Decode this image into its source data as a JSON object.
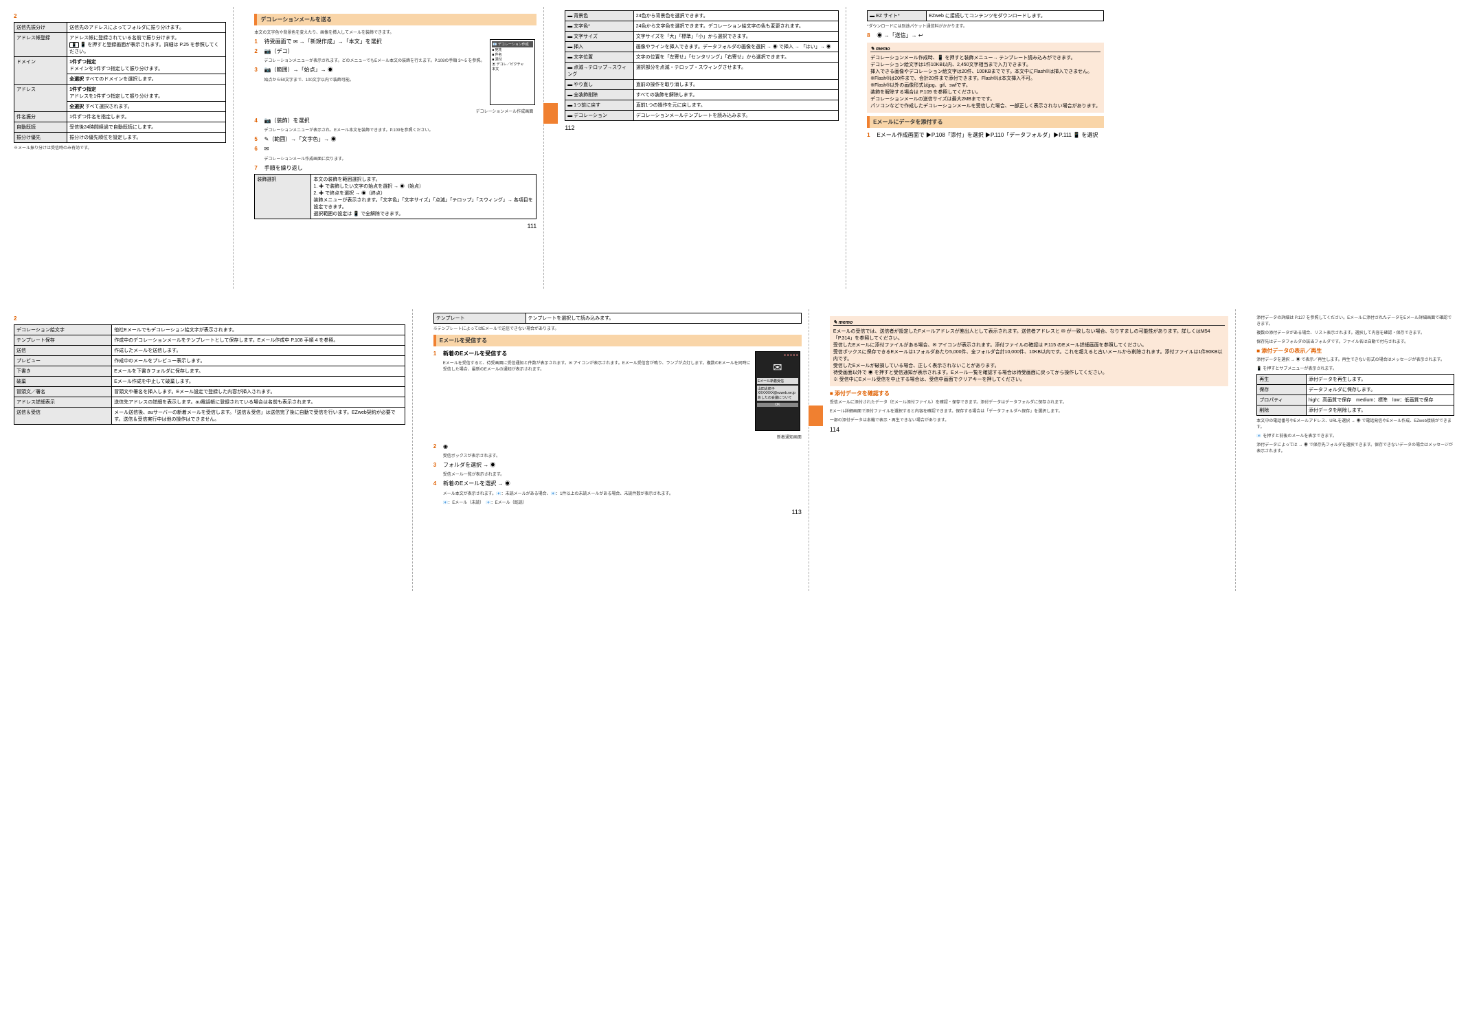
{
  "page111": {
    "number": "111",
    "section_title": "デコレーションメールを送る",
    "intro": "本文の文字色や背景色を変えたり、画像を挿入してメールを装飾できます。",
    "steps": [
      {
        "n": "1",
        "text": "待受画面で ✉ →「新規作成」→「本文」を選択"
      },
      {
        "n": "2",
        "text": "📷（デコ）",
        "note": "デコレーションメニューが表示されます。どのメニューでもEメール本文の装飾を行えます。P.108の手順 3～5 を参照。"
      },
      {
        "n": "3",
        "text": "📷（範囲）→「始点」→ ◉",
        "note": "始点から50文字まで、100文字以内で装飾可能。"
      },
      {
        "n": "4",
        "text": "📷（装飾）を選択",
        "note": "デコレーションメニューが表示され、Eメール本文を装飾できます。P.109を参照ください。"
      },
      {
        "n": "5",
        "text": "✎（範囲）→「文字色」→ ◉"
      },
      {
        "n": "6",
        "text": "✉",
        "note": "デコレーションメール作成画面に戻ります。"
      },
      {
        "n": "7",
        "text": "手順を繰り返し"
      }
    ],
    "table7": {
      "left": "装飾選択",
      "right_intro": "本文の装飾を範囲選択します。",
      "right_1": "1. ✚ で装飾したい文字の始点を選択 → ◉（始点）",
      "right_2": "2. ✚ で終点を選択 → ◉（終点）",
      "right_note": "装飾メニューが表示されます。「文字色」「文字サイズ」「点滅」「テロップ」「スウィング」→ 各項目を設定できます。",
      "right_footer": "選択範囲の設定は 📱 で全解除できます。"
    },
    "phone": {
      "header": "📧 デコレーション作成",
      "line1": "■ 宛先",
      "line2": "■ 件名",
      "line3": "■ 添付",
      "line4": "▣ デコレ／ピクチャ",
      "line5": "本文",
      "footer": "デコレーションメール作成画面"
    },
    "leftcol": {
      "step2": "2",
      "table": [
        {
          "label": "送信先振分け",
          "value": "送信先のアドレスによってフォルダに振り分けます。"
        },
        {
          "label": "アドレス帳登録",
          "value_pre": "アドレス帳に登録されている名前で振り分けます。",
          "value_mid": "📱 を押すと登録画面が表示されます。詳細は P.25 を参照してください。"
        },
        {
          "label": "ドメイン",
          "sublabel": "1件ずつ指定",
          "value": "ドメインを1件ずつ指定して振り分けます。"
        },
        {
          "label2": "全選択",
          "value2": "すべてのドメインを選択します。"
        },
        {
          "label": "アドレス",
          "sublabel": "1件ずつ指定",
          "value": "アドレスを1件ずつ指定して振り分けます。"
        },
        {
          "label2": "全選択",
          "value2": "すべて選択されます。"
        },
        {
          "label": "件名振分",
          "value": "1件ずつ件名を指定します。"
        },
        {
          "label": "自動既読",
          "value": "受信後24時間経過で自動既読にします。"
        },
        {
          "label": "振分け優先",
          "value": "振分けの優先順位を設定します。"
        }
      ],
      "footnote": "※メール振り分けは受信時のみ有効です。"
    }
  },
  "page112": {
    "number": "112",
    "table": [
      {
        "icon": "▬",
        "label": "背景色",
        "value": "24色から背景色を選択できます。"
      },
      {
        "icon": "▬",
        "label": "文字色*",
        "value": "24色から文字色を選択できます。デコレーション絵文字の色も変更されます。"
      },
      {
        "icon": "▬",
        "label": "文字サイズ",
        "value": "文字サイズを「大」「標準」「小」から選択できます。"
      },
      {
        "icon": "▬",
        "label": "挿入",
        "value": "画像やラインを挿入できます。データフォルダの画像を選択 → ◉ で挿入 → 「はい」→ ◉"
      },
      {
        "icon": "▬",
        "label": "文字位置",
        "value": "文字の位置を「左寄せ」「センタリング」「右寄せ」から選択できます。"
      },
      {
        "icon": "▬",
        "label": "点滅→テロップ→スウィング",
        "value": "選択部分を点滅・テロップ・スウィングさせます。"
      },
      {
        "icon": "▬",
        "label": "やり直し",
        "value": "直前の操作を取り消します。"
      },
      {
        "icon": "▬",
        "label": "全装飾削除",
        "value": "すべての装飾を解除します。"
      },
      {
        "icon": "▬",
        "label": "1つ前に戻す",
        "value": "直前1つの操作を元に戻します。"
      },
      {
        "icon": "▬",
        "label": "デコレーション",
        "value": "デコレーションメールテンプレートを読み込みます。"
      }
    ]
  },
  "page113_top": {
    "number": "",
    "step8": {
      "n": "8",
      "text": "◉ →「送信」→ ↩"
    },
    "memo_items": [
      "デコレーションメール作成時、📱 を押すと装飾メニュー→ テンプレート読み込みができます。",
      "デコレーション絵文字は1件10KB以内、2,450文字相当まで入力できます。",
      "挿入できる画像やデコレーション絵文字は20件、100KBまでです。本文中にFlash®は挿入できません。",
      "※Flash®は20件まで、合計20件まで添付できます。Flash®は本文挿入不可。",
      "※Flash®以外の画像形式はjpg、gif、swfです。",
      "装飾を解除する場合は P.109 を参照してください。",
      "デコレーションメールの送信サイズは最大2MBまでです。",
      "パソコンなどで作成したデコレーションメールを受信した場合、一部正しく表示されない場合があります。"
    ],
    "section_title": "Eメールにデータを添付する",
    "step1": {
      "n": "1",
      "text": "Eメール作成画面で ▶P.108「添付」を選択 ▶P.110「データフォルダ」▶P.111 📱 を選択"
    },
    "ez_table": {
      "left": "▬ EZ サイト*",
      "right": "EZweb に接続してコンテンツをダウンロードします。"
    },
    "ez_note": "*ダウンロードには別途パケット通信料がかかります。"
  },
  "page113_bottom": {
    "number": "113",
    "leftcol": {
      "step2": "2",
      "table": [
        {
          "label": "デコレーション絵文字",
          "value": "他社Eメールでもデコレーション絵文字が表示されます。"
        },
        {
          "label": "テンプレート保存",
          "value": "作成中のデコレーションメールをテンプレートとして保存します。Eメール作成中 P.108 手順 4 を参照。"
        },
        {
          "label": "送信",
          "value": "作成したメールを送信します。"
        },
        {
          "label": "プレビュー",
          "value": "作成中のメールをプレビュー表示します。"
        },
        {
          "label": "下書き",
          "value": "Eメールを下書きフォルダに保存します。"
        },
        {
          "label": "破棄",
          "value": "Eメール作成を中止して破棄します。"
        },
        {
          "label": "冒頭文／署名",
          "value": "冒頭文や署名を挿入します。Eメール設定で登録した内容が挿入されます。"
        },
        {
          "label": "アドレス詳細表示",
          "value": "送信先アドレスの詳細を表示します。au電話帳に登録されている場合は名前も表示されます。"
        },
        {
          "label": "送信＆受信",
          "value": "メール送信後、auサーバーの新着メールを受信します。「送信＆受信」は送信完了後に自動で受信を行います。EZweb契約が必要です。送信＆受信実行中は他の操作はできません。"
        }
      ]
    },
    "midcol": {
      "toptable": {
        "label": "テンプレート",
        "value": "テンプレートを選択して読み込みます。"
      },
      "topnote": "※テンプレートによってはEメールで送信できない場合があります。",
      "section_title": "Eメールを受信する",
      "steps": [
        {
          "n": "1",
          "text": "新着のEメールを受信する",
          "note": "Eメールを受信すると、待受画面に受信通知と件数が表示されます。✉ アイコンが表示されます。Eメール受信音が鳴り、ランプが点灯します。複数のEメールを同時に受信した場合、最新のEメールの通知が表示されます。"
        },
        {
          "n": "2",
          "text": "◉",
          "note": "受信ボックスが表示されます。"
        },
        {
          "n": "3",
          "text": "フォルダを選択 → ◉",
          "note": "受信メール一覧が表示されます。"
        },
        {
          "n": "4",
          "text": "新着のEメールを選択 → ◉",
          "note": "メール本文が表示されます。📧：未読メールがある場合、📧：1件以上の未読メールがある場合、未読件数が表示されます。"
        }
      ],
      "footer_icons": "📧：Eメール（未読）　📧：Eメール（既読）",
      "phone": {
        "dots": "● ● ● ● ●",
        "icon": "✉",
        "title": "Eメール新着受信",
        "from": "山田太郎子",
        "addr": "XXXXXXX@ezweb.ne.jp",
        "subj": "あしたの会議について",
        "button": "OK",
        "caption": "新着通知画面"
      }
    }
  },
  "page114": {
    "number": "114",
    "memo_items": [
      "Eメールの受信では、送信者が設定したFメールアドレスが差出人として表示されます。送信者アドレスと ✉ が一致しない場合、なりすましの可能性があります。詳しくはM54「P.314」を参照してください。",
      "受信したEメールに添付ファイルがある場合、✉ アイコンが表示されます。添付ファイルの確認は P.115 のEメール詳細画面を参照してください。",
      "受信ボックスに保存できるEメールは1フォルダあたり5,000件、全フォルダ合計10,000件、10KB以内です。これを超えると古いメールから削除されます。添付ファイルは1件90KB以内です。",
      "受信したEメールが破損している場合、正しく表示されないことがあります。",
      "待受画面以外で ◉ を押すと受信通知が表示されます。Eメール一覧を確認する場合は待受画面に戻ってから操作してください。",
      "※ 受信中にEメール受信を中止する場合は、受信中画面でクリアキーを押してください。"
    ],
    "sub_title": "■ 添付データを確認する",
    "sub_body": [
      "受信メールに添付されたデータ（Eメール添付ファイル）を確認・保存できます。添付データはデータフォルダに保存されます。",
      "Eメール詳細画面で添付ファイルを選択すると内容を確認できます。保存する場合は「データフォルダへ保存」を選択します。",
      "一部の添付データは本機で表示・再生できない場合があります。"
    ]
  },
  "page114_right": {
    "intro": [
      "添付データの詳細は P.127 を参照してください。Eメールに添付されたデータをEメール詳細画面で確認できます。",
      "複数の添付データがある場合、リスト表示されます。選択して内容を確認・保存できます。",
      "保存先はデータフォルダの該当フォルダです。ファイル名は自動で付与されます。"
    ],
    "sub_title": "■ 添付データの表示／再生",
    "sub_body": [
      "添付データを選択 → ◉ で表示／再生します。再生できない形式の場合はメッセージが表示されます。",
      "📱 を押すとサブメニューが表示されます。"
    ],
    "table": [
      {
        "label": "再生",
        "value": "添付データを再生します。"
      },
      {
        "label": "保存",
        "value": "データフォルダに保存します。"
      },
      {
        "label": "プロパティ",
        "value": "high：高画質で保存　medium：標準　low：低画質で保存"
      },
      {
        "label": "削除",
        "value": "添付データを削除します。"
      }
    ],
    "footer": [
      "本文中の電話番号やEメールアドレス、URLを選択 → ◉ で電話発信やEメール作成、EZweb接続ができます。",
      "📧 を押すと前後のメールを表示できます。",
      "添付データによっては → ◉ で保存先フォルダを選択できます。保存できないデータの場合はメッセージが表示されます。"
    ]
  }
}
